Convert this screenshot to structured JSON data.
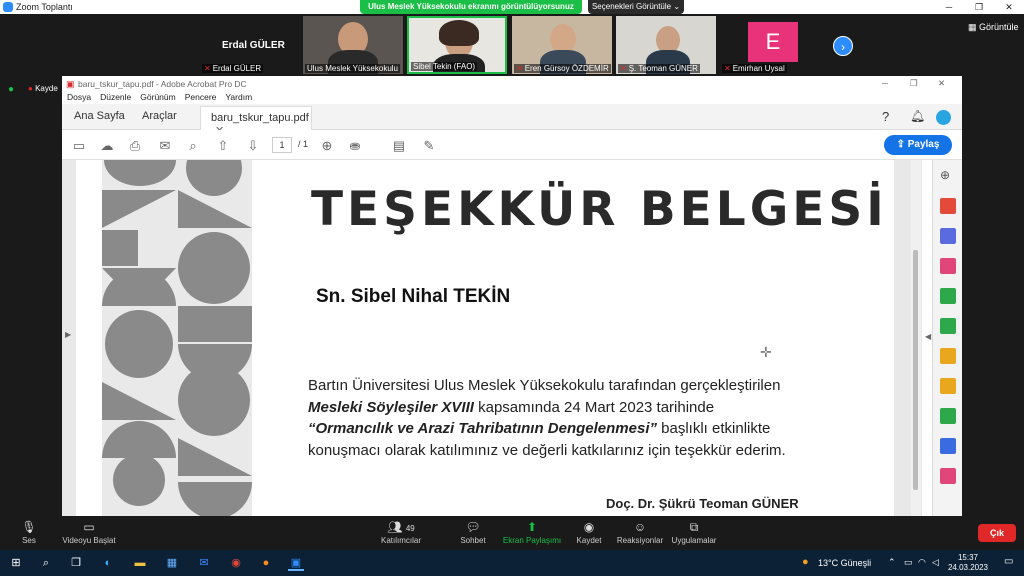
{
  "zoom": {
    "window_title": "Zoom Toplantı",
    "share_banner": "Ulus Meslek Yüksekokulu ekranını görüntülüyorsunuz",
    "view_options": "Seçenekleri Görüntüle",
    "view_label": "Görüntüle",
    "participants": [
      {
        "name": "Erdal GÜLER",
        "tile_label": "Erdal GÜLER"
      },
      {
        "name": "Ulus Meslek Yüksekokulu"
      },
      {
        "name": "Sibel Tekin (FAO)"
      },
      {
        "name": "Eren Gürsoy ÖZDEMİR"
      },
      {
        "name": "Ş. Teoman GÜNER"
      },
      {
        "name": "Emirhan Uysal",
        "initial": "E"
      }
    ],
    "recording_label": "Kayde",
    "controls": {
      "audio": "Ses",
      "video": "Videoyu Başlat",
      "participants": "Katılımcılar",
      "participants_count": "49",
      "chat": "Sohbet",
      "share": "Ekran Paylaşımı",
      "record": "Kaydet",
      "reactions": "Reaksiyonlar",
      "apps": "Uygulamalar",
      "leave": "Çık"
    }
  },
  "acrobat": {
    "title": "baru_tskur_tapu.pdf - Adobe Acrobat Pro DC",
    "menu": [
      "Dosya",
      "Düzenle",
      "Görünüm",
      "Pencere",
      "Yardım"
    ],
    "tabs": [
      "Ana Sayfa",
      "Araçlar"
    ],
    "doc_tab": "baru_tskur_tapu.pdf",
    "page_current": "1",
    "page_total": "/ 1",
    "share_label": "Paylaş"
  },
  "certificate": {
    "title": "TEŞEKKÜR BELGESİ",
    "recipient": "Sn. Sibel Nihal TEKİN",
    "body_1": "Bartın Üniversitesi Ulus Meslek Yüksekokulu tarafından gerçekleştirilen",
    "body_2_italic": "Mesleki Söyleşiler XVIII",
    "body_2_rest": " kapsamında 24 Mart 2023 tarihinde",
    "body_3_italic": "“Ormancılık ve Arazi Tahribatının Dengelenmesi”",
    "body_3_rest": " başlıklı etkinlikte",
    "body_4": "konuşmacı olarak katılımınız ve değerli katkılarınız için teşekkür ederim.",
    "signer": "Doç. Dr. Şükrü Teoman GÜNER"
  },
  "taskbar": {
    "weather": "13°C  Güneşli",
    "time": "15:37",
    "date": "24.03.2023"
  }
}
